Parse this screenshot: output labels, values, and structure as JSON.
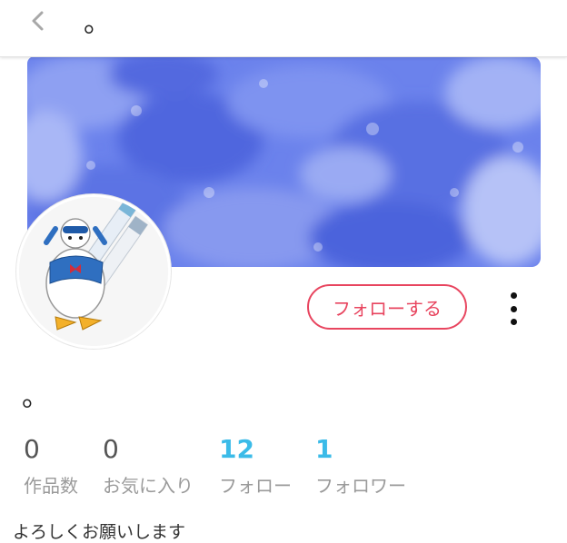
{
  "header": {
    "back_icon": "chevron-left-icon",
    "title": "。"
  },
  "profile": {
    "follow_label": "フォローする",
    "more_icon": "vertical-ellipsis-icon",
    "name": "。",
    "bio": "よろしくお願いします",
    "stats": [
      {
        "value": "0",
        "label": "作品数"
      },
      {
        "value": "0",
        "label": "お気に入り"
      },
      {
        "value": "12",
        "label": "フォロー"
      },
      {
        "value": "1",
        "label": "フォロワー"
      }
    ]
  },
  "colors": {
    "accent_blue": "#3bbbe8",
    "follow_red": "#e8455f",
    "cover_blue": "#5a72e6"
  }
}
